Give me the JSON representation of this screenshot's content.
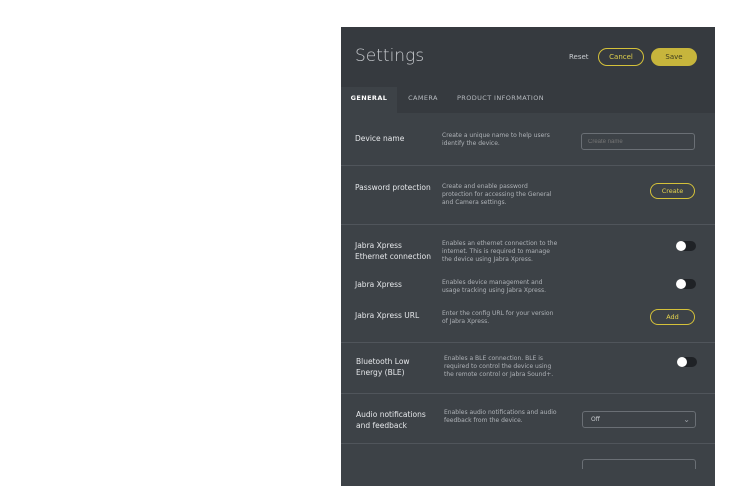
{
  "header": {
    "title": "Settings",
    "reset_label": "Reset",
    "cancel_label": "Cancel",
    "save_label": "Save"
  },
  "tabs": [
    {
      "label": "GENERAL",
      "active": true
    },
    {
      "label": "CAMERA",
      "active": false
    },
    {
      "label": "PRODUCT INFORMATION",
      "active": false
    }
  ],
  "settings": {
    "device_name": {
      "label": "Device name",
      "description": "Create a unique name to help users identify the device.",
      "placeholder": "Create name"
    },
    "password_protection": {
      "label": "Password protection",
      "description": "Create and enable password protection for accessing the General and Camera settings.",
      "button_label": "Create"
    },
    "xpress_ethernet": {
      "label": "Jabra Xpress Ethernet connection",
      "description": "Enables an ethernet connection to the internet. This is required to manage the device using Jabra Xpress.",
      "enabled": false
    },
    "xpress": {
      "label": "Jabra Xpress",
      "description": "Enables device management and usage tracking using Jabra Xpress.",
      "enabled": false
    },
    "xpress_url": {
      "label": "Jabra Xpress URL",
      "description": "Enter the config URL for your version of Jabra Xpress.",
      "button_label": "Add"
    },
    "ble": {
      "label": "Bluetooth Low Energy (BLE)",
      "description": "Enables a BLE connection. BLE is required to control the device using the remote control or Jabra Sound+.",
      "enabled": false
    },
    "audio_notifications": {
      "label": "Audio notifications and feedback",
      "description": "Enables audio notifications and audio feedback from the device.",
      "selected": "Off"
    }
  },
  "colors": {
    "accent": "#d4c13a",
    "panel": "#3d4247",
    "header": "#363a3f"
  },
  "icons": {
    "select_arrow": "chevron-down-icon"
  }
}
